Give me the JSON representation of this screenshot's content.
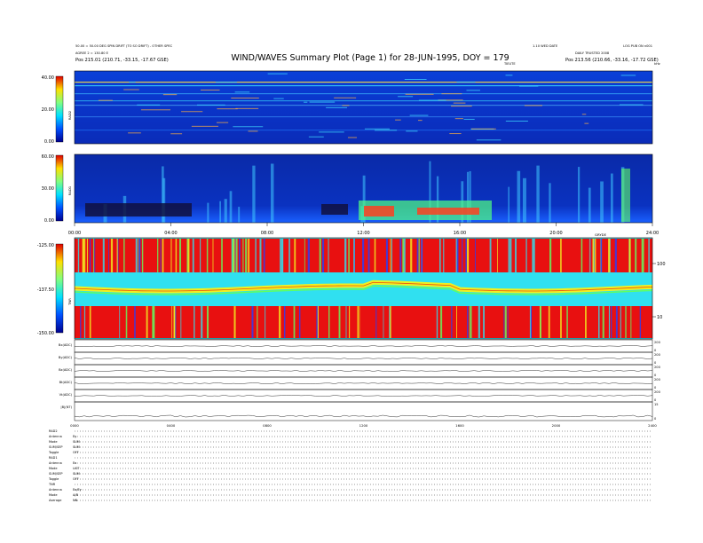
{
  "header": {
    "title": "WIND/WAVES Summary Plot (Page 1) for 28-JUN-1995, DOY = 179",
    "left_line1": "50.00 = 50.00 DEG SPIN DRIFT (TO SO DRIFT) - OTHER SPEC",
    "left_line2": "AGREE 2 = 130.80 E",
    "left_line3": "Pos   215.01 (210.71, -33.15, -17.67 GSE)",
    "right_line1": "1.10 WED DATE",
    "right_line2": "DAILY TRUSTED 2008",
    "right_line3": "Pos   213.56 (210.66, -33.16, -17.72 GSE)",
    "right_extra": "LOG PUB ON n001",
    "center_small": "TIEUTE",
    "right_corner": "kHz"
  },
  "chart_data": [
    {
      "type": "heatmap",
      "panel": "RAD2",
      "ylabel": "RAD2",
      "colorbar_ticks": [
        "40.00",
        "20.00",
        "0.00"
      ],
      "colorbar_range": [
        0,
        40
      ]
    },
    {
      "type": "heatmap",
      "panel": "RAD1",
      "ylabel": "RAD1",
      "colorbar_ticks": [
        "60.00",
        "30.00",
        "0.00"
      ],
      "colorbar_range": [
        0,
        60
      ],
      "x_ticks": [
        "00:00",
        "04:00",
        "08:00",
        "12:00",
        "16:00",
        "20:00",
        "24:00"
      ]
    },
    {
      "type": "heatmap",
      "panel": "TNR",
      "ylabel": "TNR",
      "colorbar_ticks": [
        "-125.00",
        "-137.50",
        "-150.00"
      ],
      "colorbar_range": [
        -150,
        -125
      ],
      "right_ticks": [
        "100",
        "10"
      ],
      "annotation": "GRYDE"
    },
    {
      "type": "scatter",
      "panels": [
        "Bx(ADC)",
        "By(ADC)",
        "Bz(ADC)",
        "Bt(ADC)",
        "Vt(ADC)",
        "|B|(NT)"
      ],
      "right_ticks": [
        [
          "200",
          "0"
        ],
        [
          "200",
          "0"
        ],
        [
          "200",
          "0"
        ],
        [
          "200",
          "0"
        ],
        [
          "200",
          "0"
        ],
        [
          "15",
          "0"
        ]
      ],
      "x_ticks": [
        "0000",
        "0400",
        "0800",
        "1200",
        "1600",
        "2000",
        "2400"
      ]
    }
  ],
  "legend": [
    {
      "label": "RAD2",
      "value": ""
    },
    {
      "label": "Antenna",
      "value": "Ey"
    },
    {
      "label": "Mode",
      "value": "SUM"
    },
    {
      "label": "SUM/SEP",
      "value": "SUM"
    },
    {
      "label": "Toggle",
      "value": "OFF"
    },
    {
      "label": "RAD1",
      "value": ""
    },
    {
      "label": "Antenna",
      "value": "Ex"
    },
    {
      "label": "Mode",
      "value": "LIST"
    },
    {
      "label": "SUM/SEP",
      "value": "SUM"
    },
    {
      "label": "Toggle",
      "value": "OFF"
    },
    {
      "label": "TNR",
      "value": ""
    },
    {
      "label": "Antenna",
      "value": "Ex/Ey"
    },
    {
      "label": "Mode",
      "value": "A/B"
    },
    {
      "label": "Average",
      "value": "NN"
    }
  ]
}
